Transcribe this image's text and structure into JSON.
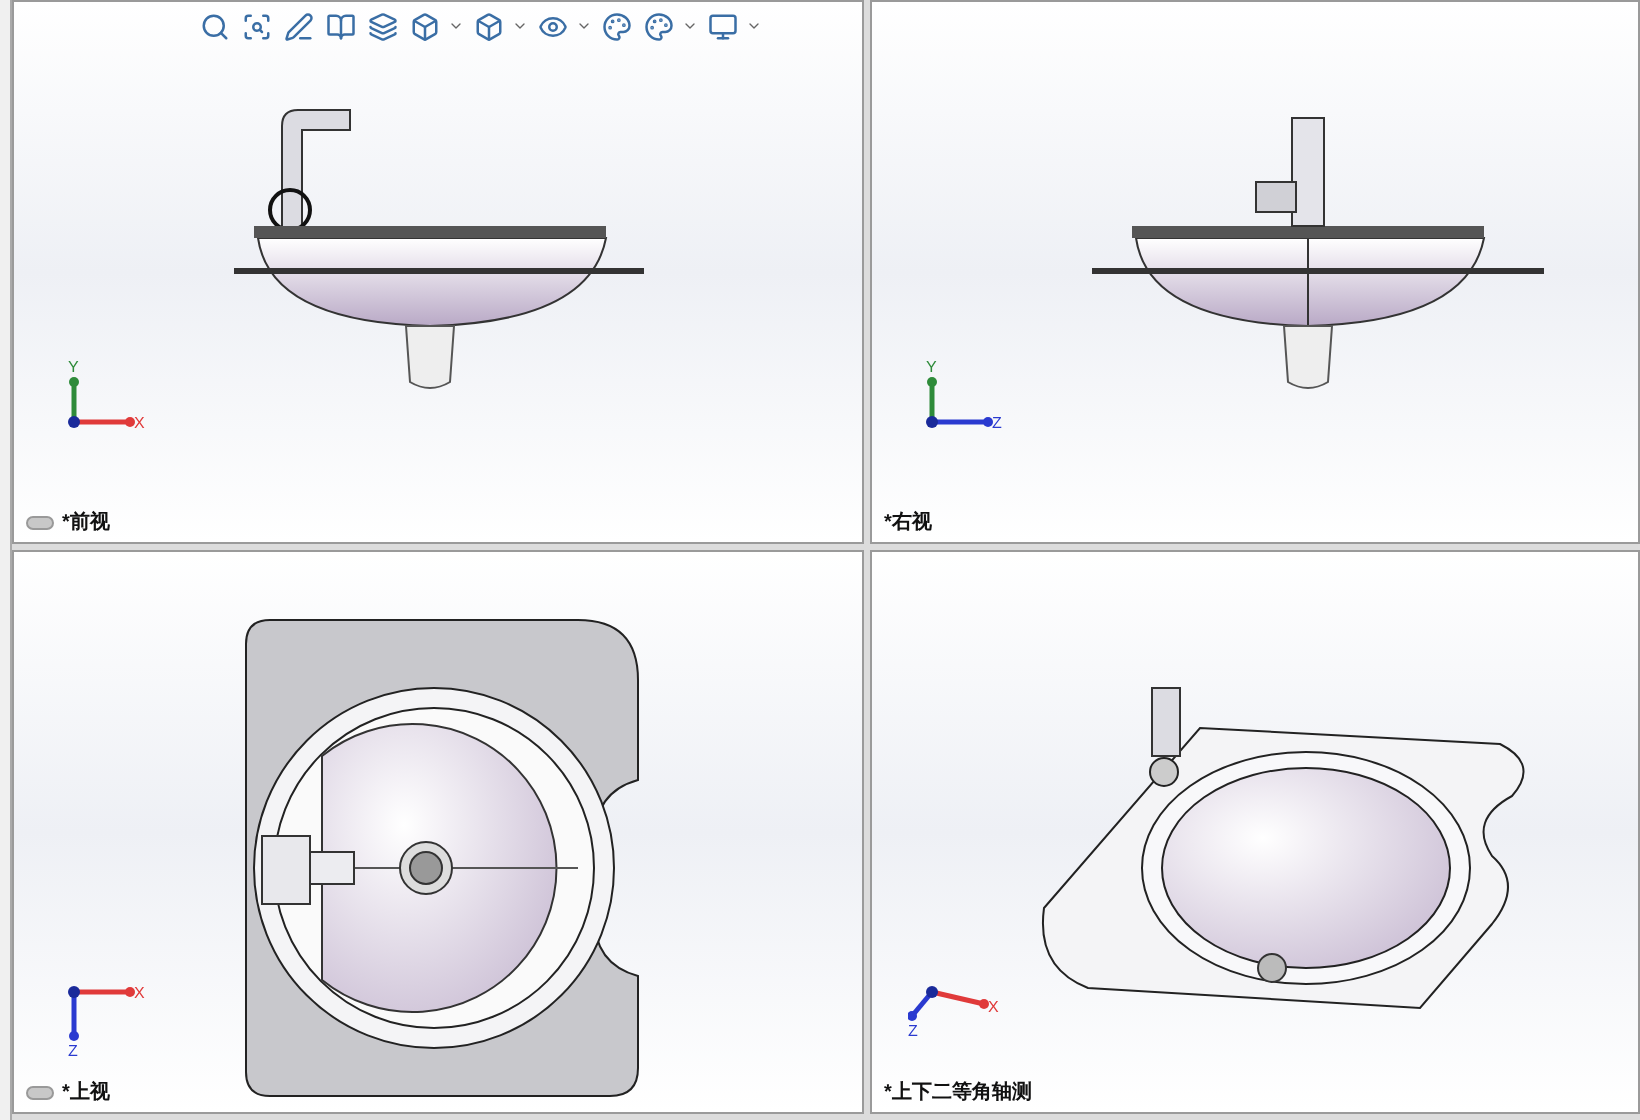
{
  "viewports": [
    {
      "label": "*前视",
      "kind": "front",
      "axes": [
        {
          "label": "Y",
          "color": "#2e8b3a",
          "kind": "up"
        },
        {
          "label": "X",
          "color": "#e03a3a",
          "kind": "right"
        }
      ]
    },
    {
      "label": "*右视",
      "kind": "right",
      "axes": [
        {
          "label": "Y",
          "color": "#2e8b3a",
          "kind": "up"
        },
        {
          "label": "Z",
          "color": "#2a3ad0",
          "kind": "right"
        }
      ]
    },
    {
      "label": "*上视",
      "kind": "top",
      "axes": [
        {
          "label": "X",
          "color": "#e03a3a",
          "kind": "right"
        },
        {
          "label": "Z",
          "color": "#2a3ad0",
          "kind": "down"
        }
      ]
    },
    {
      "label": "*上下二等角轴测",
      "kind": "iso",
      "axes": [
        {
          "label": "X",
          "color": "#e03a3a",
          "kind": "downright"
        },
        {
          "label": "Z",
          "color": "#2a3ad0",
          "kind": "downleft"
        }
      ]
    }
  ]
}
